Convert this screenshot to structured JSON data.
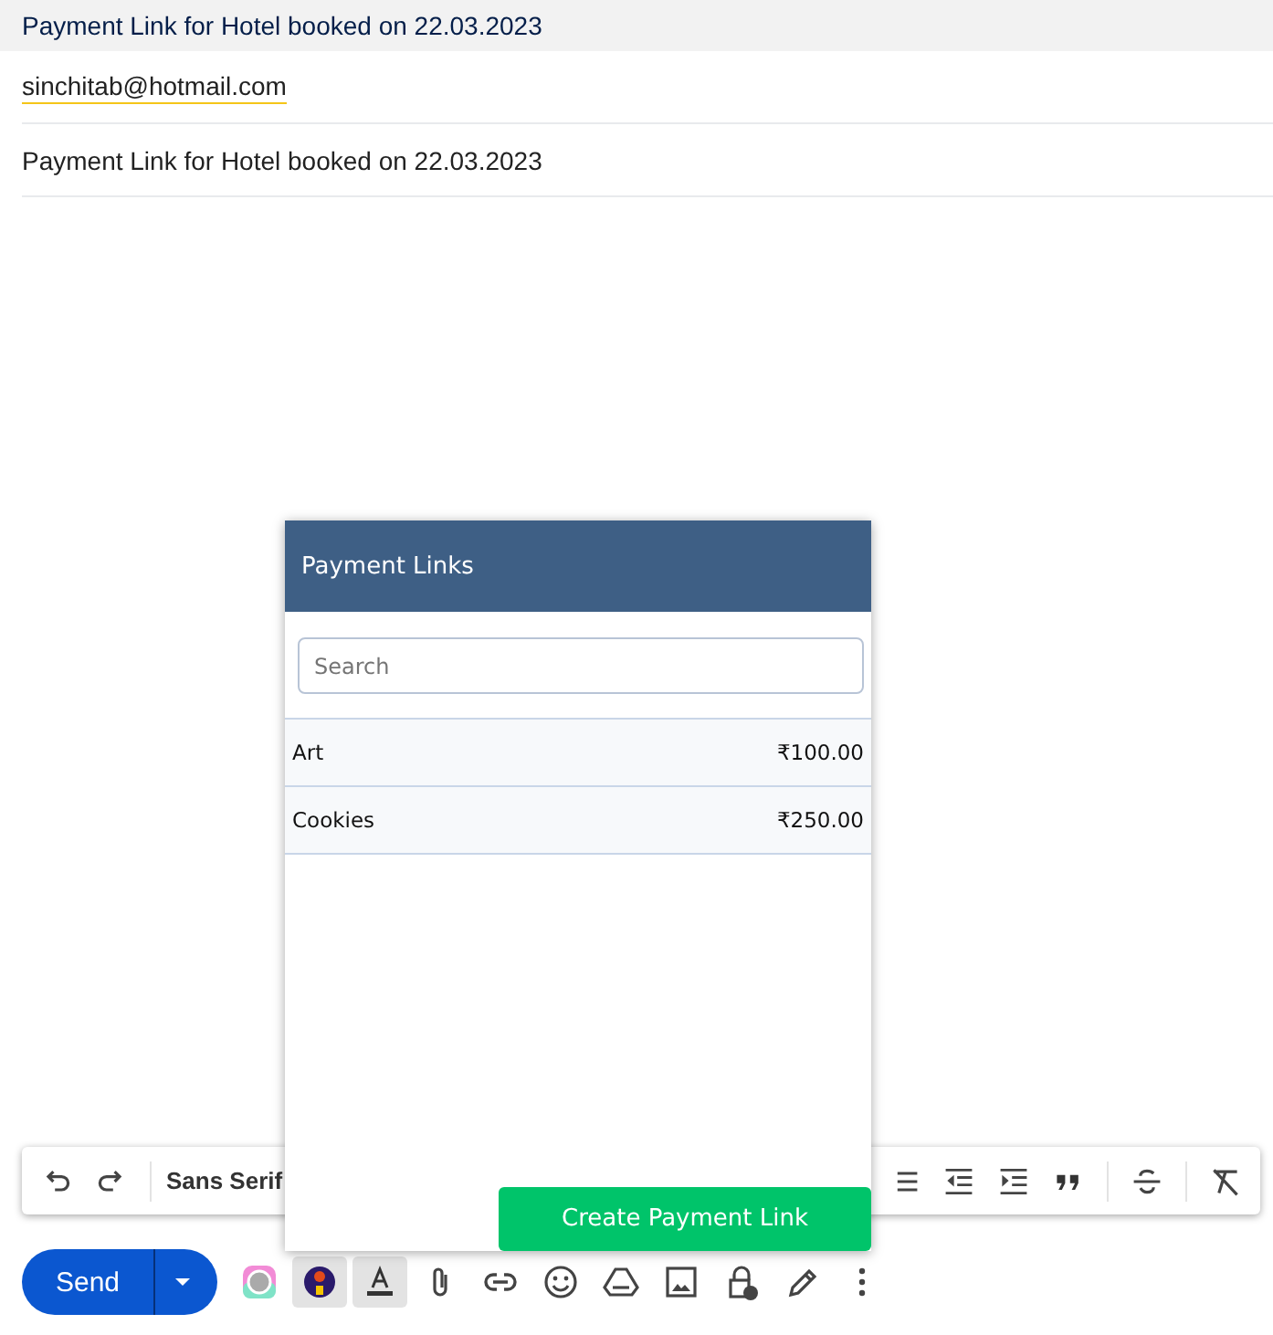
{
  "header": {
    "title": "Payment Link for Hotel booked on 22.03.2023"
  },
  "recipient": "sinchitab@hotmail.com",
  "subject": "Payment Link for Hotel booked on 22.03.2023",
  "popup": {
    "title": "Payment Links",
    "search": {
      "placeholder": "Search"
    },
    "items": [
      {
        "name": "Art",
        "amount": "₹100.00"
      },
      {
        "name": "Cookies",
        "amount": "₹250.00"
      }
    ],
    "button": "Create Payment Link"
  },
  "format_toolbar": {
    "font": "Sans Serif"
  },
  "send": {
    "label": "Send"
  },
  "bottom_tools": [
    {
      "kind": "app",
      "selected": false
    },
    {
      "kind": "avatar",
      "selected": true
    },
    {
      "kind": "textcolor",
      "selected": true
    },
    {
      "kind": "attach",
      "selected": false
    },
    {
      "kind": "link",
      "selected": false
    },
    {
      "kind": "emoji",
      "selected": false
    },
    {
      "kind": "drive",
      "selected": false
    },
    {
      "kind": "image",
      "selected": false
    },
    {
      "kind": "lock",
      "selected": false
    },
    {
      "kind": "pen",
      "selected": false
    },
    {
      "kind": "more",
      "selected": false
    }
  ]
}
